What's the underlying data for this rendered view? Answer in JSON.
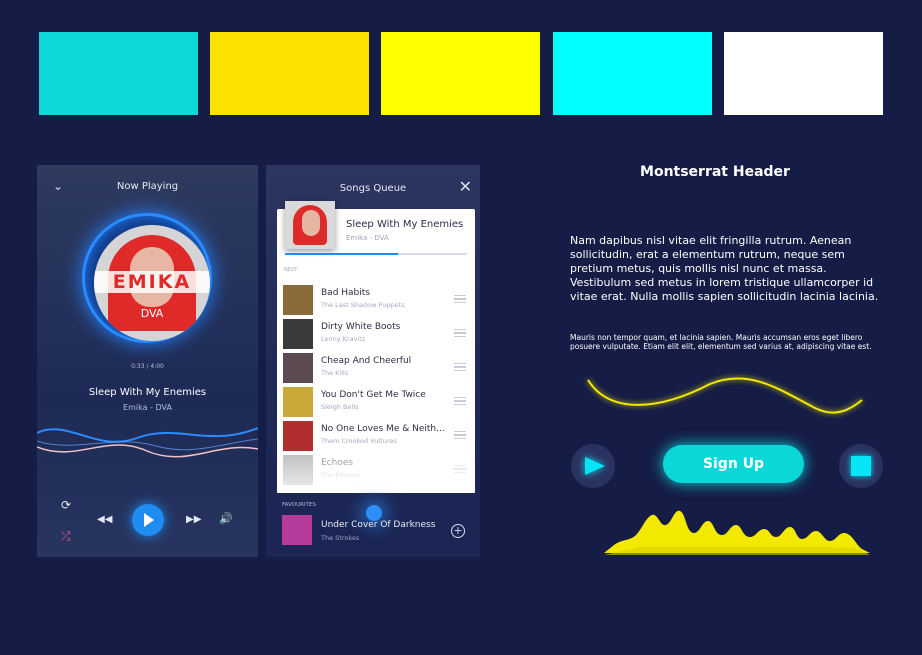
{
  "palette": [
    "#0ed8d8",
    "#fde200",
    "#ffff00",
    "#00ffff",
    "#ffffff"
  ],
  "player": {
    "header": "Now Playing",
    "album_band": "EMIKA",
    "album_sub": "DVA",
    "time": "0:33 / 4:00",
    "title": "Sleep With My Enemies",
    "artist": "Emika - DVA",
    "progress": 0.1375
  },
  "queue": {
    "header": "Songs Queue",
    "current": {
      "title": "Sleep With My Enemies",
      "artist": "Emika - DVA",
      "progress": 0.62
    },
    "next_label": "NEXT:",
    "items": [
      {
        "title": "Bad Habits",
        "artist": "The Last Shadow Puppets",
        "color": "#8a6a3a"
      },
      {
        "title": "Dirty White Boots",
        "artist": "Lenny Kravitz",
        "color": "#3a3a3a"
      },
      {
        "title": "Cheap And Cheerful",
        "artist": "The Kills",
        "color": "#5c4a52"
      },
      {
        "title": "You Don't Get Me Twice",
        "artist": "Sleigh Bells",
        "color": "#c9a93a"
      },
      {
        "title": "No One Loves Me & Neith...",
        "artist": "Them Crooked Vultures",
        "color": "#b12e2e"
      },
      {
        "title": "Echoes",
        "artist": "The Klaxons",
        "color": "#8d8d8d"
      }
    ],
    "favourites_label": "FAVOURITES",
    "favourite": {
      "title": "Under Cover Of Darkness",
      "artist": "The Strokes",
      "color": "#b53a9a"
    }
  },
  "panel": {
    "header": "Montserrat Header",
    "paragraph1": "Nam dapibus nisl vitae elit fringilla rutrum. Aenean sollicitudin, erat a elementum rutrum, neque sem pretium metus, quis mollis nisl nunc et massa. Vestibulum sed metus in lorem tristique ullamcorper id vitae erat. Nulla mollis sapien sollicitudin lacinia lacinia.",
    "paragraph2": "Mauris non tempor quam, et lacinia sapien. Mauris accumsan eros eget libero posuere vulputate. Etiam elit elit, elementum sed varius at, adipiscing vitae est.",
    "signup_label": "Sign Up",
    "accent": "#f2e800"
  }
}
